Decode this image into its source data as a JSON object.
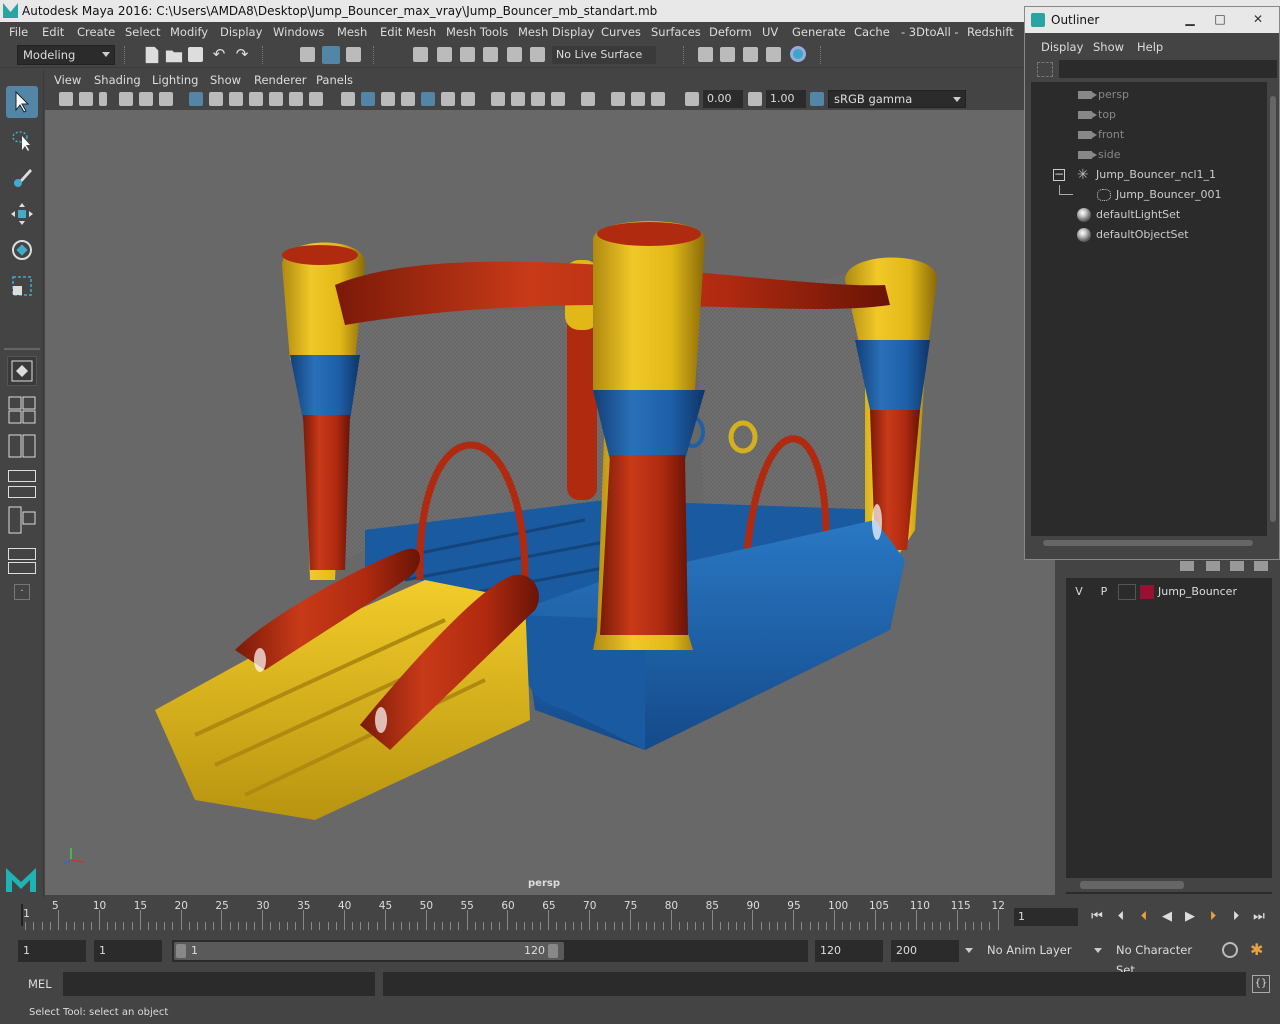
{
  "window": {
    "title": "Autodesk Maya 2016: C:\\Users\\AMDA8\\Desktop\\Jump_Bouncer_max_vray\\Jump_Bouncer_mb_standart.mb"
  },
  "menubar": [
    "File",
    "Edit",
    "Create",
    "Select",
    "Modify",
    "Display",
    "Windows",
    "Mesh",
    "Edit Mesh",
    "Mesh Tools",
    "Mesh Display",
    "Curves",
    "Surfaces",
    "Deform",
    "UV",
    "Generate",
    "Cache",
    "- 3DtoAll -",
    "Redshift"
  ],
  "shelf": {
    "menuset": "Modeling",
    "live_surface": "No Live Surface"
  },
  "viewport": {
    "menus": [
      "View",
      "Shading",
      "Lighting",
      "Show",
      "Renderer",
      "Panels"
    ],
    "exposure": "0.00",
    "gamma": "1.00",
    "color_space": "sRGB gamma",
    "camera_label": "persp"
  },
  "outliner": {
    "title": "Outliner",
    "menus": [
      "Display",
      "Show",
      "Help"
    ],
    "items": [
      {
        "label": "persp",
        "kind": "camera",
        "dim": true
      },
      {
        "label": "top",
        "kind": "camera",
        "dim": true
      },
      {
        "label": "front",
        "kind": "camera",
        "dim": true
      },
      {
        "label": "side",
        "kind": "camera",
        "dim": true
      },
      {
        "label": "Jump_Bouncer_ncl1_1",
        "kind": "group"
      },
      {
        "label": "Jump_Bouncer_001",
        "kind": "mesh"
      },
      {
        "label": "defaultLightSet",
        "kind": "set"
      },
      {
        "label": "defaultObjectSet",
        "kind": "set"
      }
    ]
  },
  "layers": {
    "rows": [
      {
        "v": "V",
        "p": "P",
        "name": "Jump_Bouncer",
        "color": "#9a1030"
      }
    ]
  },
  "timeline": {
    "ticks": [
      "5",
      "10",
      "15",
      "20",
      "25",
      "30",
      "35",
      "40",
      "45",
      "50",
      "55",
      "60",
      "65",
      "70",
      "75",
      "80",
      "85",
      "90",
      "95",
      "100",
      "105",
      "110",
      "115",
      "12"
    ],
    "current_frame_marker": "1",
    "current_frame": "1"
  },
  "range": {
    "start": "1",
    "playback_start": "1",
    "slider_start": "1",
    "slider_end": "120",
    "playback_end": "120",
    "end": "200",
    "anim_layer": "No Anim Layer",
    "character_set": "No Character Set"
  },
  "commandline": {
    "label": "MEL"
  },
  "helpline": {
    "text": "Select Tool: select an object"
  },
  "colors": {
    "accent": "#5285a6",
    "panel": "#444444",
    "field": "#2b2b2b",
    "viewport_bg": "#686868",
    "bouncer_yellow": "#e8c020",
    "bouncer_red": "#b02a10",
    "bouncer_blue": "#1d5fa8"
  }
}
